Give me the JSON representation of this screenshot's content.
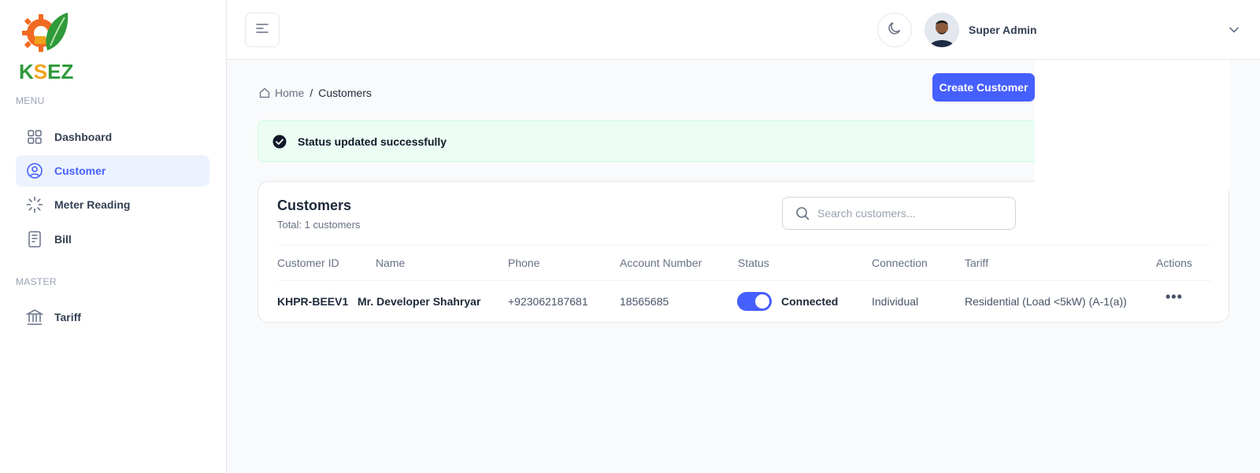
{
  "sidebar": {
    "logo": {
      "k": "K",
      "s": "S",
      "ez": "EZ"
    },
    "menu_label": "MENU",
    "master_label": "MASTER",
    "items": [
      {
        "label": "Dashboard",
        "icon": "grid-icon",
        "active": false
      },
      {
        "label": "Customer",
        "icon": "user-circle-icon",
        "active": true
      },
      {
        "label": "Meter Reading",
        "icon": "loader-icon",
        "active": false
      },
      {
        "label": "Bill",
        "icon": "document-icon",
        "active": false
      }
    ],
    "master_items": [
      {
        "label": "Tariff",
        "icon": "bank-icon",
        "active": false
      }
    ]
  },
  "header": {
    "user_name": "Super Admin"
  },
  "breadcrumb": {
    "home": "Home",
    "separator": "/",
    "current": "Customers"
  },
  "actions": {
    "create_label": "Create Customer"
  },
  "alert": {
    "message": "Status updated successfully"
  },
  "card": {
    "title": "Customers",
    "subtitle": "Total: 1 customers",
    "search_placeholder": "Search customers...",
    "columns": [
      "Customer ID",
      "Name",
      "Phone",
      "Account Number",
      "Status",
      "Connection",
      "Tariff",
      "Actions"
    ],
    "rows": [
      {
        "customer_id": "KHPR-BEEV1",
        "name": "Mr. Developer Shahryar",
        "phone": "+923062187681",
        "account_number": "18565685",
        "status": "Connected",
        "connection": "Individual",
        "tariff": "Residential (Load <5kW) (A-1(a))",
        "actions": "•••"
      }
    ]
  },
  "colors": {
    "primary": "#465fff",
    "active_bg": "#ecf3ff",
    "success_bg": "#ecfdf3"
  }
}
